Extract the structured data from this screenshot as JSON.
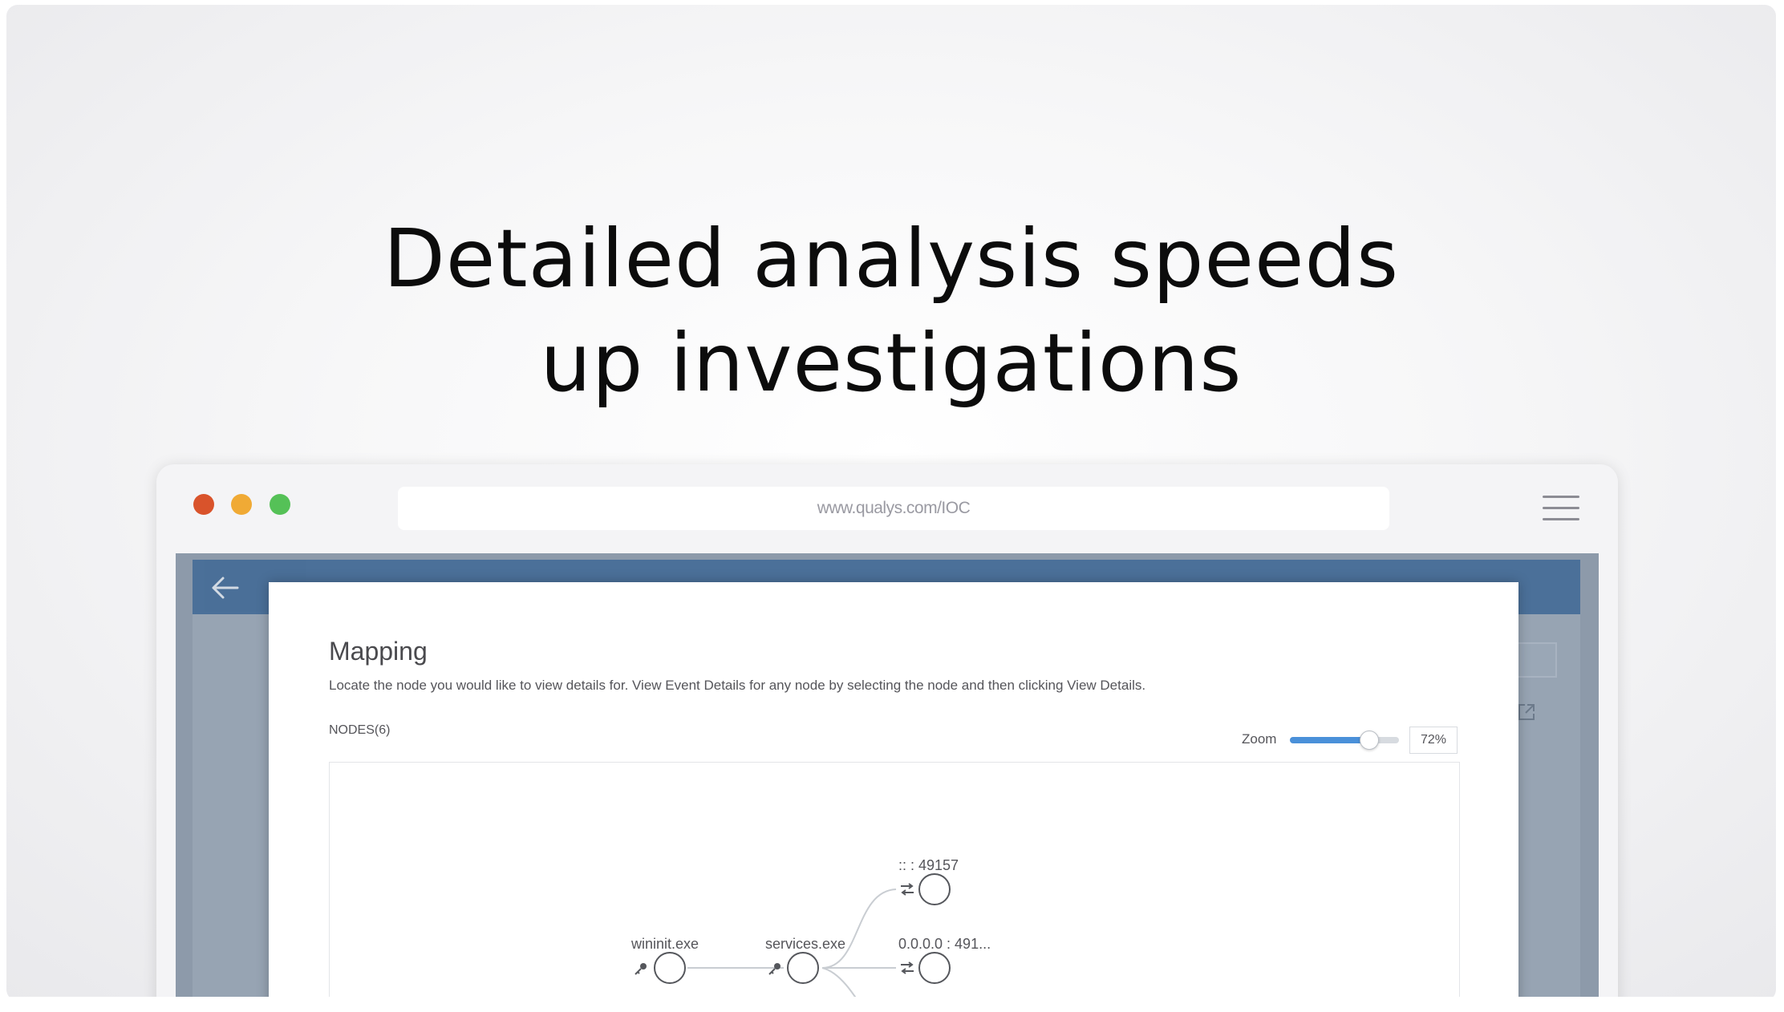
{
  "headline": {
    "line1": "Detailed analysis speeds",
    "line2": "up investigations"
  },
  "browser": {
    "url": "www.qualys.com/IOC",
    "traffic_lights": {
      "red": "#d9532b",
      "yellow": "#f0aa35",
      "green": "#55c157"
    }
  },
  "modal": {
    "title": "Mapping",
    "description": "Locate the node you would like to view details for. View Event Details for any node by selecting the node and then clicking View Details.",
    "nodes_label": "NODES(6)",
    "zoom": {
      "label": "Zoom",
      "value": "72%",
      "level": 0.72
    }
  },
  "graph": {
    "nodes": [
      {
        "id": "wininit",
        "label": "wininit.exe",
        "icon": "key-icon"
      },
      {
        "id": "services",
        "label": "services.exe",
        "icon": "key-icon"
      },
      {
        "id": "ip1",
        "label": ":: : 49157",
        "icon": "network-arrows-icon"
      },
      {
        "id": "ip2",
        "label": "0.0.0.0 : 491...",
        "icon": "network-arrows-icon"
      }
    ]
  },
  "colors": {
    "header_blue": "#3f6896",
    "accent": "#4a90d9"
  }
}
